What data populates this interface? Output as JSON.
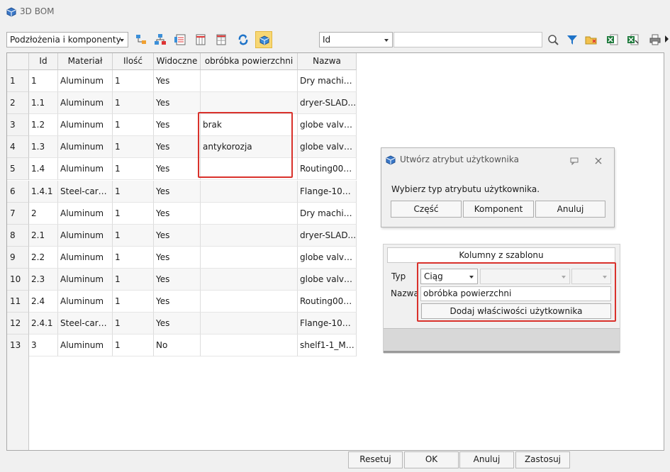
{
  "window": {
    "title": "3D BOM"
  },
  "toolbar": {
    "view_select": "Podzłożenia i komponenty",
    "search_field_select": "Id",
    "search_value": ""
  },
  "grid": {
    "columns": [
      "Id",
      "Materiał",
      "Ilość",
      "Widoczne",
      "obróbka powierzchni",
      "Nazwa"
    ],
    "rows": [
      {
        "n": "1",
        "id": "1",
        "mat": "Aluminum",
        "qty": "1",
        "vis": "Yes",
        "surf": "",
        "name": "Dry machin..."
      },
      {
        "n": "2",
        "id": "1.1",
        "mat": "Aluminum",
        "qty": "1",
        "vis": "Yes",
        "surf": "",
        "name": "dryer-SLAD..."
      },
      {
        "n": "3",
        "id": "1.2",
        "mat": "Aluminum",
        "qty": "1",
        "vis": "Yes",
        "surf": "brak",
        "name": "globe valve ..."
      },
      {
        "n": "4",
        "id": "1.3",
        "mat": "Aluminum",
        "qty": "1",
        "vis": "Yes",
        "surf": "antykorozja",
        "name": "globe valve ..."
      },
      {
        "n": "5",
        "id": "1.4",
        "mat": "Aluminum",
        "qty": "1",
        "vis": "Yes",
        "surf": "",
        "name": "Routing004..."
      },
      {
        "n": "6",
        "id": "1.4.1",
        "mat": "Steel-carbon",
        "qty": "1",
        "vis": "Yes",
        "surf": "",
        "name": "Flange-100-..."
      },
      {
        "n": "7",
        "id": "2",
        "mat": "Aluminum",
        "qty": "1",
        "vis": "Yes",
        "surf": "",
        "name": "Dry machin..."
      },
      {
        "n": "8",
        "id": "2.1",
        "mat": "Aluminum",
        "qty": "1",
        "vis": "Yes",
        "surf": "",
        "name": "dryer-SLAD..."
      },
      {
        "n": "9",
        "id": "2.2",
        "mat": "Aluminum",
        "qty": "1",
        "vis": "Yes",
        "surf": "",
        "name": "globe valve ..."
      },
      {
        "n": "10",
        "id": "2.3",
        "mat": "Aluminum",
        "qty": "1",
        "vis": "Yes",
        "surf": "",
        "name": "globe valve ..."
      },
      {
        "n": "11",
        "id": "2.4",
        "mat": "Aluminum",
        "qty": "1",
        "vis": "Yes",
        "surf": "",
        "name": "Routing004..."
      },
      {
        "n": "12",
        "id": "2.4.1",
        "mat": "Steel-carbon",
        "qty": "1",
        "vis": "Yes",
        "surf": "",
        "name": "Flange-100-..."
      },
      {
        "n": "13",
        "id": "3",
        "mat": "Aluminum",
        "qty": "1",
        "vis": "No",
        "surf": "",
        "name": "shelf1-1_Mi..."
      }
    ]
  },
  "dialog": {
    "title": "Utwórz atrybut użytkownika",
    "prompt": "Wybierz typ atrybutu użytkownika.",
    "buttons": [
      "Część",
      "Komponent",
      "Anuluj"
    ]
  },
  "template_panel": {
    "header": "Kolumny z szablonu",
    "type_label": "Typ",
    "type_value": "Ciąg",
    "name_label": "Nazwa",
    "name_value": "obróbka powierzchni",
    "add_button": "Dodaj właściwości użytkownika"
  },
  "footer": {
    "reset": "Resetuj",
    "ok": "OK",
    "cancel": "Anuluj",
    "apply": "Zastosuj"
  },
  "colors": {
    "highlight_red": "#d9312b",
    "active_tool": "#f7d774"
  }
}
